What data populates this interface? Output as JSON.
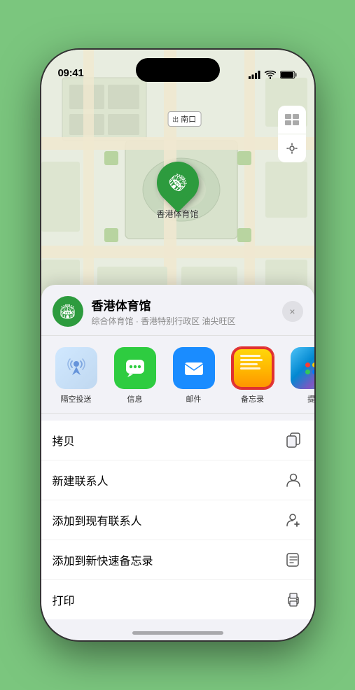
{
  "status": {
    "time": "09:41",
    "location_arrow": true
  },
  "map": {
    "label_nankou": "南口",
    "venue_pin_label": "香港体育馆"
  },
  "sheet": {
    "venue_name": "香港体育馆",
    "venue_subtitle": "综合体育馆 · 香港特别行政区 油尖旺区",
    "close_label": "×"
  },
  "share_items": [
    {
      "id": "airdrop",
      "label": "隔空投送",
      "type": "airdrop"
    },
    {
      "id": "messages",
      "label": "信息",
      "type": "messages"
    },
    {
      "id": "mail",
      "label": "邮件",
      "type": "mail"
    },
    {
      "id": "notes",
      "label": "备忘录",
      "type": "notes"
    },
    {
      "id": "more",
      "label": "提",
      "type": "more"
    }
  ],
  "actions": [
    {
      "id": "copy",
      "label": "拷贝",
      "icon": "copy"
    },
    {
      "id": "new-contact",
      "label": "新建联系人",
      "icon": "person"
    },
    {
      "id": "add-existing",
      "label": "添加到现有联系人",
      "icon": "person-add"
    },
    {
      "id": "add-notes",
      "label": "添加到新快速备忘录",
      "icon": "note"
    },
    {
      "id": "print",
      "label": "打印",
      "icon": "print"
    }
  ]
}
